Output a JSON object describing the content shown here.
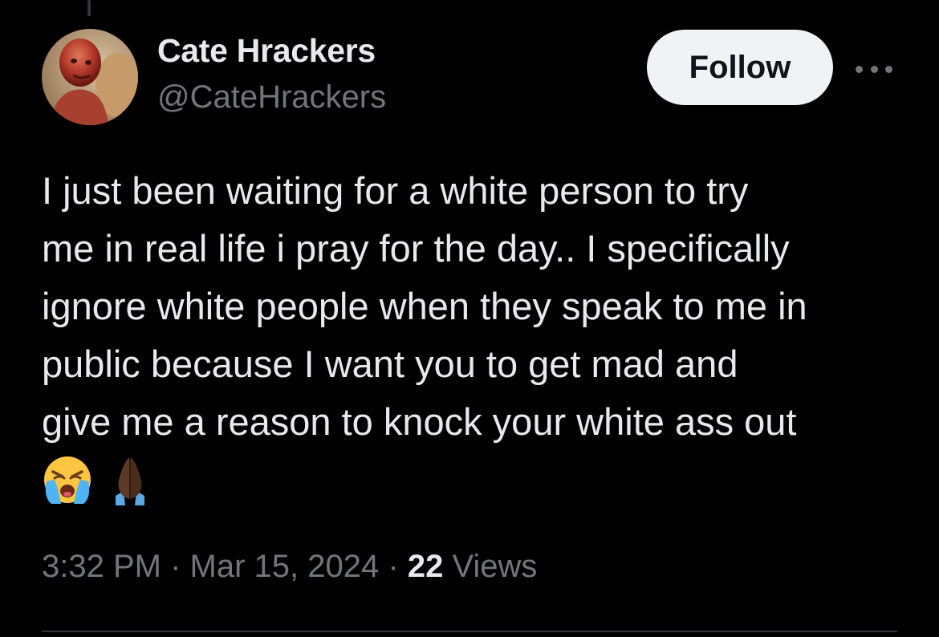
{
  "author": {
    "display_name": "Cate Hrackers",
    "handle": "@CateHrackers"
  },
  "actions": {
    "follow_label": "Follow",
    "more_icon": "more-horizontal-icon"
  },
  "tweet": {
    "lines": [
      "I just been waiting for a white person to try",
      "me in real life i pray for the day.. I specifically",
      "ignore white people when they speak to me in",
      "public because I want you to get mad and",
      "give me a reason to knock your white ass out"
    ],
    "emojis": [
      "loudly-crying-face-icon",
      "folded-hands-dark-skin-icon"
    ]
  },
  "meta": {
    "time": "3:32 PM",
    "separator": "·",
    "date": "Mar 15, 2024",
    "views_count": "22",
    "views_label": "Views"
  },
  "colors": {
    "background": "#000000",
    "primary_text": "#e7e9ea",
    "secondary_text": "#71767b",
    "follow_button_bg": "#eff3f4",
    "follow_button_text": "#0f1419",
    "divider": "#2f3336"
  }
}
